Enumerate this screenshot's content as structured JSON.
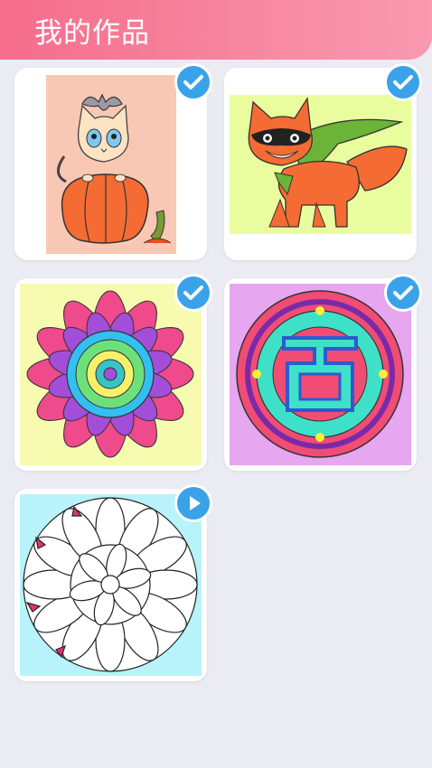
{
  "header": {
    "title": "我的作品"
  },
  "artworks": [
    {
      "name": "cat-in-pumpkin",
      "status": "completed",
      "status_icon": "check-icon",
      "bg": "#f9c8b4"
    },
    {
      "name": "superhero-fox",
      "status": "completed",
      "status_icon": "check-icon",
      "bg": "#eafd9e"
    },
    {
      "name": "pink-mandala",
      "status": "completed",
      "status_icon": "check-icon",
      "bg": "#f7fbb0"
    },
    {
      "name": "teal-ornament",
      "status": "completed",
      "status_icon": "check-icon",
      "bg": "#e6a6f0"
    },
    {
      "name": "uncolored-mandala",
      "status": "in-progress",
      "status_icon": "play-icon",
      "bg": "#b8f2fb"
    }
  ]
}
